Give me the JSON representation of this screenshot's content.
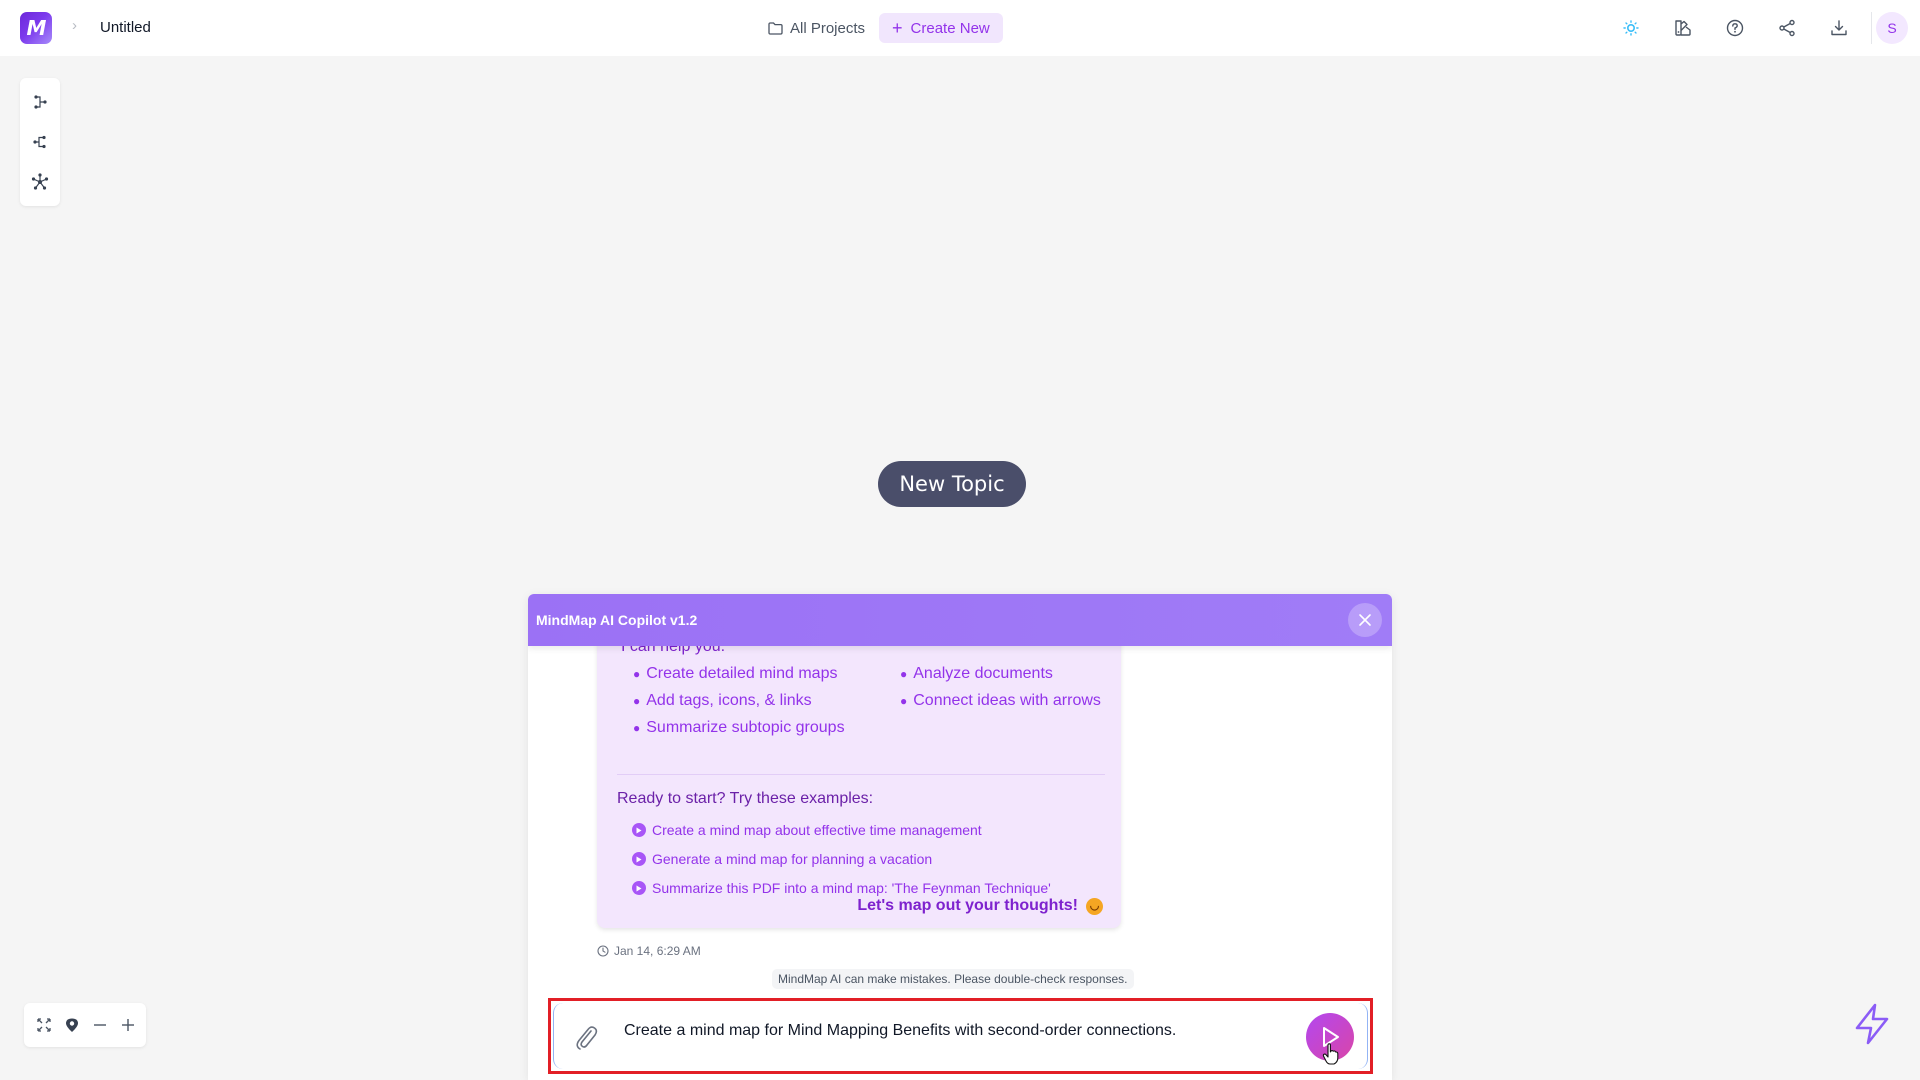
{
  "header": {
    "logo_letter": "M",
    "breadcrumb_separator": "›",
    "document_title": "Untitled",
    "all_projects_label": "All Projects",
    "create_new_label": "Create New",
    "create_new_icon": "+",
    "avatar_initial": "S",
    "icons": [
      "theme-sun-icon",
      "palette-icon",
      "help-icon",
      "share-icon",
      "download-icon"
    ]
  },
  "layout_toolbar": {
    "items": [
      "layout-right-tree-icon",
      "layout-left-tree-icon",
      "layout-radial-icon"
    ]
  },
  "canvas": {
    "central_topic": "New Topic"
  },
  "copilot": {
    "title": "MindMap AI Copilot v1.2",
    "intro": "I can help you:",
    "capabilities": [
      "Create detailed mind maps",
      "Analyze documents",
      "Add tags, icons, & links",
      "Connect ideas with arrows",
      "Summarize subtopic groups"
    ],
    "examples_title": "Ready to start? Try these examples:",
    "examples": [
      "Create a mind map about effective time management",
      "Generate a mind map for planning a vacation",
      "Summarize this PDF into a mind map: 'The Feynman Technique'"
    ],
    "signoff": "Let's map out your thoughts!",
    "signoff_emoji": "😊",
    "timestamp": "Jan 14, 6:29 AM",
    "disclaimer": "MindMap AI can make mistakes. Please double-check responses.",
    "input_value": "Create a mind map for Mind Mapping Benefits with second-order connections.",
    "colors": {
      "header": "#9b71f5",
      "card_bg": "#f3e6fd",
      "accent": "#9333ea",
      "highlight_border": "#e21f26"
    }
  },
  "zoom_controls": {
    "items": [
      "fit-screen-icon",
      "locate-icon",
      "zoom-out-icon",
      "zoom-in-icon"
    ]
  },
  "quick_action": "lightning-icon"
}
